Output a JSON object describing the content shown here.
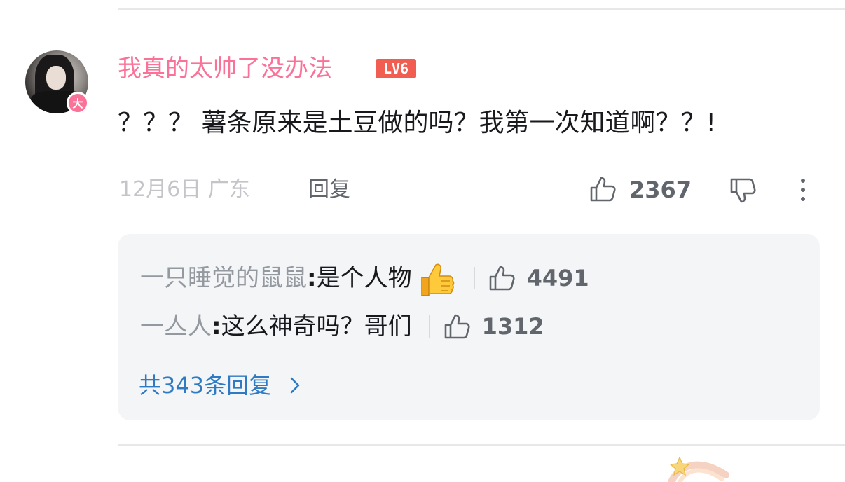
{
  "comment": {
    "username": "我真的太帅了没办法",
    "level": "LV6",
    "avatar_badge": "大",
    "text": "？？？ 薯条原来是土豆做的吗？我第一次知道啊？？!",
    "date_location": "12月6日 广东",
    "reply_label": "回复",
    "like_count": "2367",
    "icons": {
      "like": "thumbs-up-outline-icon",
      "dislike": "thumbs-down-outline-icon",
      "more": "vertical-ellipsis-icon"
    }
  },
  "sub_replies": [
    {
      "username": "一只睡觉的鼠鼠",
      "colon": ":",
      "text": " 是个人物",
      "emoji": "thumbs-up-emoji",
      "like_count": "4491"
    },
    {
      "username": "一亼人",
      "colon": ":",
      "text": " 这么神奇吗？哥们",
      "like_count": "1312"
    }
  ],
  "total_replies_label": "共343条回复",
  "colors": {
    "username_pink": "#fb7299",
    "level_red": "#f25d52",
    "link_blue": "#2e7bc4",
    "muted_gray": "#9499a0",
    "reply_bg": "#f4f5f7"
  }
}
